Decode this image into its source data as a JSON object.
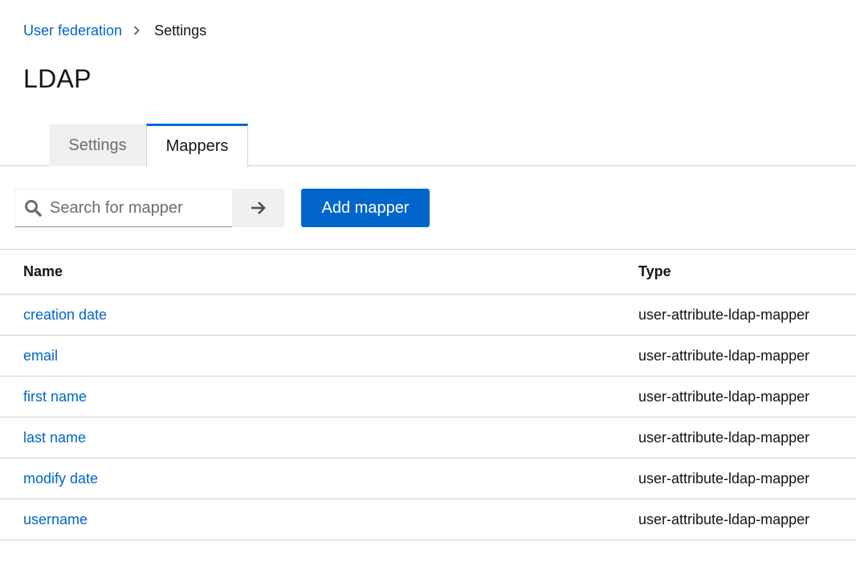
{
  "breadcrumb": {
    "parent": "User federation",
    "current": "Settings"
  },
  "page": {
    "title": "LDAP"
  },
  "tabs": [
    {
      "label": "Settings",
      "active": false
    },
    {
      "label": "Mappers",
      "active": true
    }
  ],
  "toolbar": {
    "search_placeholder": "Search for mapper",
    "search_value": "",
    "add_label": "Add mapper"
  },
  "table": {
    "columns": [
      "Name",
      "Type"
    ],
    "rows": [
      {
        "name": "creation date",
        "type": "user-attribute-ldap-mapper"
      },
      {
        "name": "email",
        "type": "user-attribute-ldap-mapper"
      },
      {
        "name": "first name",
        "type": "user-attribute-ldap-mapper"
      },
      {
        "name": "last name",
        "type": "user-attribute-ldap-mapper"
      },
      {
        "name": "modify date",
        "type": "user-attribute-ldap-mapper"
      },
      {
        "name": "username",
        "type": "user-attribute-ldap-mapper"
      }
    ]
  },
  "colors": {
    "link": "#0066cc",
    "primary_button": "#0066cc",
    "text": "#151515",
    "muted_text": "#6a6e73",
    "border": "#d2d2d2",
    "inactive_tab": "#f0f0f0"
  },
  "icons": {
    "breadcrumb_separator": "chevron-right-icon",
    "search": "search-icon",
    "search_submit": "arrow-right-icon"
  }
}
